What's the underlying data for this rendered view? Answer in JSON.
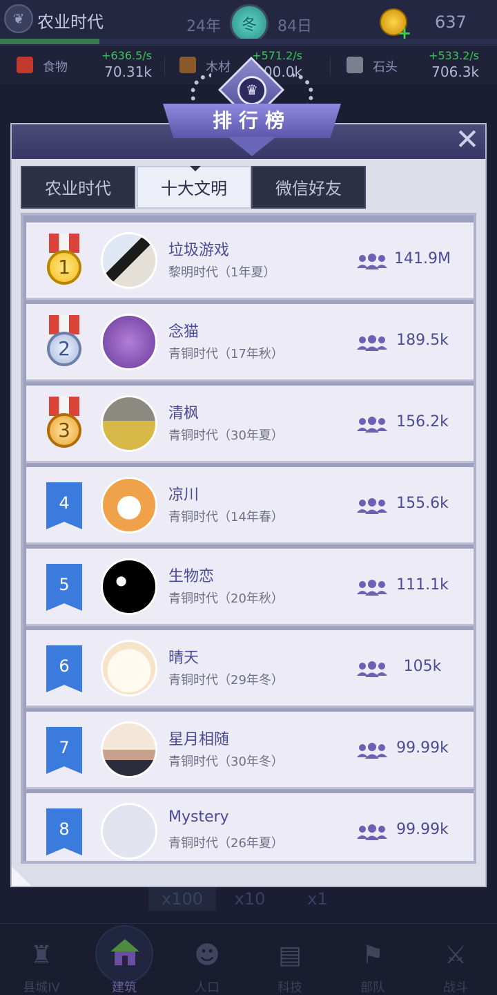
{
  "topbar": {
    "era_name": "农业时代",
    "year": "24年",
    "season": "冬",
    "day": "84日",
    "gold": "637"
  },
  "resources": [
    {
      "name": "食物",
      "rate": "+636.5/s",
      "amount": "70.31k",
      "icon": "food-icon",
      "color": "#c0392b"
    },
    {
      "name": "木材",
      "rate": "+571.2/s",
      "amount": "100.0k",
      "icon": "wood-icon",
      "color": "#8a5a2b"
    },
    {
      "name": "石头",
      "rate": "+533.2/s",
      "amount": "706.3k",
      "icon": "stone-icon",
      "color": "#7c7f8e"
    }
  ],
  "leaderboard": {
    "title": "排行榜",
    "close_icon": "close-icon",
    "tabs": [
      {
        "label": "农业时代",
        "active": false
      },
      {
        "label": "十大文明",
        "active": true
      },
      {
        "label": "微信好友",
        "active": false
      }
    ],
    "entries": [
      {
        "rank": "1",
        "name": "垃圾游戏",
        "era": "黎明时代（1年夏）",
        "population": "141.9M"
      },
      {
        "rank": "2",
        "name": "念猫",
        "era": "青铜时代（17年秋）",
        "population": "189.5k"
      },
      {
        "rank": "3",
        "name": "清枫",
        "era": "青铜时代（30年夏）",
        "population": "156.2k"
      },
      {
        "rank": "4",
        "name": "凉川",
        "era": "青铜时代（14年春）",
        "population": "155.6k"
      },
      {
        "rank": "5",
        "name": "生物恋",
        "era": "青铜时代（20年秋）",
        "population": "111.1k"
      },
      {
        "rank": "6",
        "name": "晴天",
        "era": "青铜时代（29年冬）",
        "population": "105k"
      },
      {
        "rank": "7",
        "name": "星月相随",
        "era": "青铜时代（30年冬）",
        "population": "99.99k"
      },
      {
        "rank": "8",
        "name": "Mystery",
        "era": "青铜时代（26年夏）",
        "population": "99.99k"
      }
    ]
  },
  "speed": [
    "x100",
    "x10",
    "x1"
  ],
  "nav": [
    {
      "label": "县城IV",
      "icon": "castle-icon"
    },
    {
      "label": "建筑",
      "icon": "house-icon"
    },
    {
      "label": "人口",
      "icon": "person-icon"
    },
    {
      "label": "科技",
      "icon": "book-icon"
    },
    {
      "label": "部队",
      "icon": "banner-icon"
    },
    {
      "label": "战斗",
      "icon": "swords-icon"
    }
  ]
}
